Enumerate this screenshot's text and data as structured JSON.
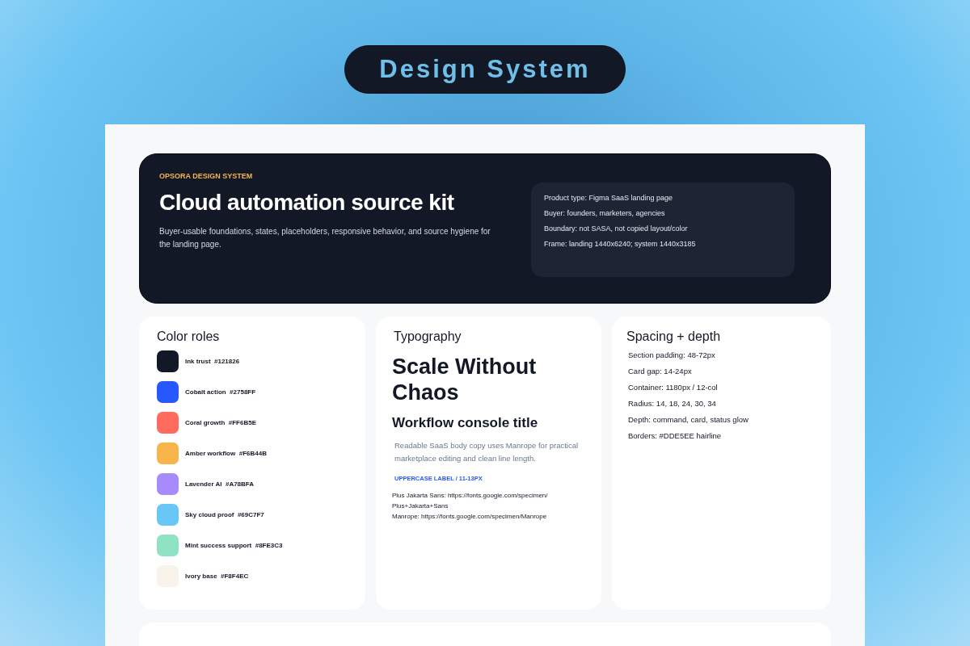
{
  "badge": "Design System",
  "hero": {
    "eyebrow": "OPSORA DESIGN SYSTEM",
    "title": "Cloud automation source kit",
    "description": "Buyer-usable foundations, states, placeholders, responsive behavior, and source hygiene for the landing page.",
    "facts": [
      "Product type: Figma SaaS landing page",
      "Buyer: founders, marketers, agencies",
      "Boundary: not SASA, not copied layout/color",
      "Frame: landing 1440x6240; system 1440x3185"
    ]
  },
  "color_roles": {
    "title": "Color roles",
    "items": [
      {
        "label": "Ink trust  #121826",
        "color": "#121826"
      },
      {
        "label": "Cobalt action  #2758FF",
        "color": "#2758ff"
      },
      {
        "label": "Coral growth  #FF6B5E",
        "color": "#ff6b5e"
      },
      {
        "label": "Amber workflow  #F6B44B",
        "color": "#f6b44b"
      },
      {
        "label": "Lavender AI  #A78BFA",
        "color": "#a78bfa"
      },
      {
        "label": "Sky cloud proof  #69C7F7",
        "color": "#69c7f7"
      },
      {
        "label": "Mint success support  #8FE3C3",
        "color": "#8fe3c3"
      },
      {
        "label": "Ivory base  #F8F4EC",
        "color": "#f8f4ec"
      }
    ]
  },
  "typography": {
    "title": "Typography",
    "display": "Scale Without Chaos",
    "heading": "Workflow console title",
    "body": "Readable SaaS body copy uses Manrope for practical marketplace editing and clean line length.",
    "label": "UPPERCASE LABEL / 11-13PX",
    "sources": [
      "Plus Jakarta Sans: https://fonts.google.com/specimen/ Plus+Jakarta+Sans",
      "Manrope: https://fonts.google.com/specimen/Manrope"
    ]
  },
  "spacing": {
    "title": "Spacing + depth",
    "items": [
      "Section padding: 48-72px",
      "Card gap: 14-24px",
      "Container: 1180px / 12-col",
      "Radius: 14, 18, 24, 30, 34",
      "Depth: command, card, status glow",
      "Borders: #DDE5EE hairline"
    ]
  }
}
